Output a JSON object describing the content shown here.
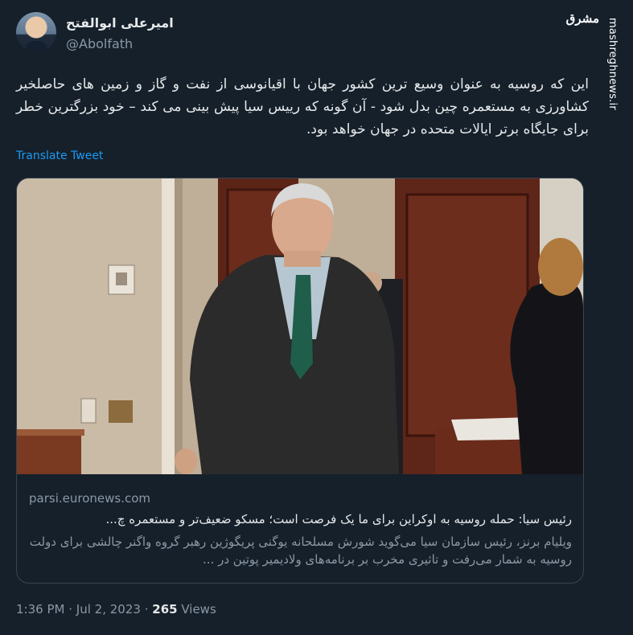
{
  "author": {
    "name": "امیرعلی ابوالفتح",
    "handle": "@Abolfath"
  },
  "watermark": {
    "logo": "مشرق",
    "site": "mashreghnews.ir"
  },
  "tweet": {
    "text": "این که روسیه به عنوان وسیع ترین کشور جهان با اقیانوسی از نفت و گاز و زمین های حاصلخیر کشاورزی به مستعمره چین بدل شود - آن گونه که رییس سیا پیش بینی می کند – خود بزرگترین خطر برای جایگاه برتر ایالات متحده در جهان خواهد بود.",
    "translate_label": "Translate Tweet"
  },
  "card": {
    "domain": "parsi.euronews.com",
    "title": "رئیس سیا: حمله روسیه به اوکراین برای ما یک فرصت است؛ مسکو ضعیف‌تر و مستعمره چ...",
    "description": "ویلیام برنز، رئیس سازمان سیا می‌گوید شورش مسلحانه یوگنی پریگوژین رهبر گروه واگنر چالشی برای دولت روسیه به شمار می‌رفت و تاثیری مخرب بر برنامه‌های ولادیمیر پوتین در ..."
  },
  "meta": {
    "time": "1:36 PM",
    "separator": "·",
    "date": "Jul 2, 2023",
    "views_count": "265",
    "views_label": "Views"
  }
}
